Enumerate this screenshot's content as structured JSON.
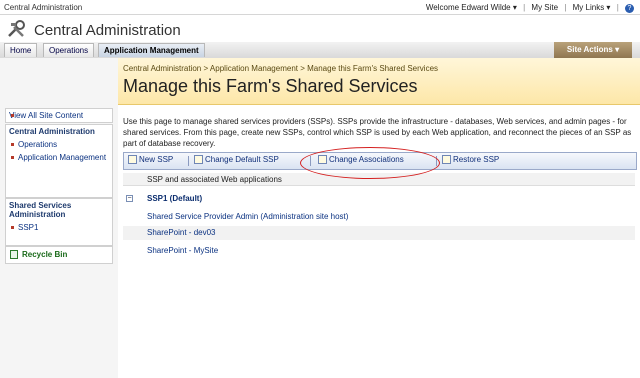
{
  "topbar": {
    "site_name": "Central Administration",
    "welcome": "Welcome Edward Wilde ▾",
    "my_site": "My Site",
    "my_links": "My Links ▾",
    "help": "?"
  },
  "app": {
    "title": "Central Administration"
  },
  "tabs": [
    {
      "label": "Home"
    },
    {
      "label": "Operations"
    },
    {
      "label": "Application Management"
    }
  ],
  "site_actions": "Site Actions ▾",
  "leftnav": {
    "view_all": "View All Site Content",
    "section1": {
      "title": "Central Administration",
      "items": [
        "Operations",
        "Application Management"
      ]
    },
    "section2": {
      "title": "Shared Services Administration",
      "items": [
        "SSP1"
      ]
    },
    "recycle_bin": "Recycle Bin"
  },
  "breadcrumb": "Central Administration > Application Management > Manage this Farm's Shared Services",
  "page_title": "Manage this Farm's Shared Services",
  "description": "Use this page to manage shared services providers (SSPs). SSPs provide the infrastructure - databases, Web services, and admin pages - for shared services. From this page, create new SSPs, control which SSP is used by each Web application, and reconnect the pieces of an SSP as part of database recovery.",
  "toolbar": {
    "new_ssp": "New SSP",
    "change_default": "Change Default SSP",
    "change_assoc": "Change Associations",
    "restore": "Restore SSP"
  },
  "table": {
    "header": "SSP and associated Web applications",
    "group": "SSP1 (Default)",
    "rows": [
      "Shared Service Provider Admin (Administration site host)",
      "SharePoint - dev03",
      "SharePoint - MySite"
    ]
  },
  "colors": {
    "accent": "#0b3281",
    "header_band": "#fde7a8",
    "annotation": "#d42020"
  }
}
